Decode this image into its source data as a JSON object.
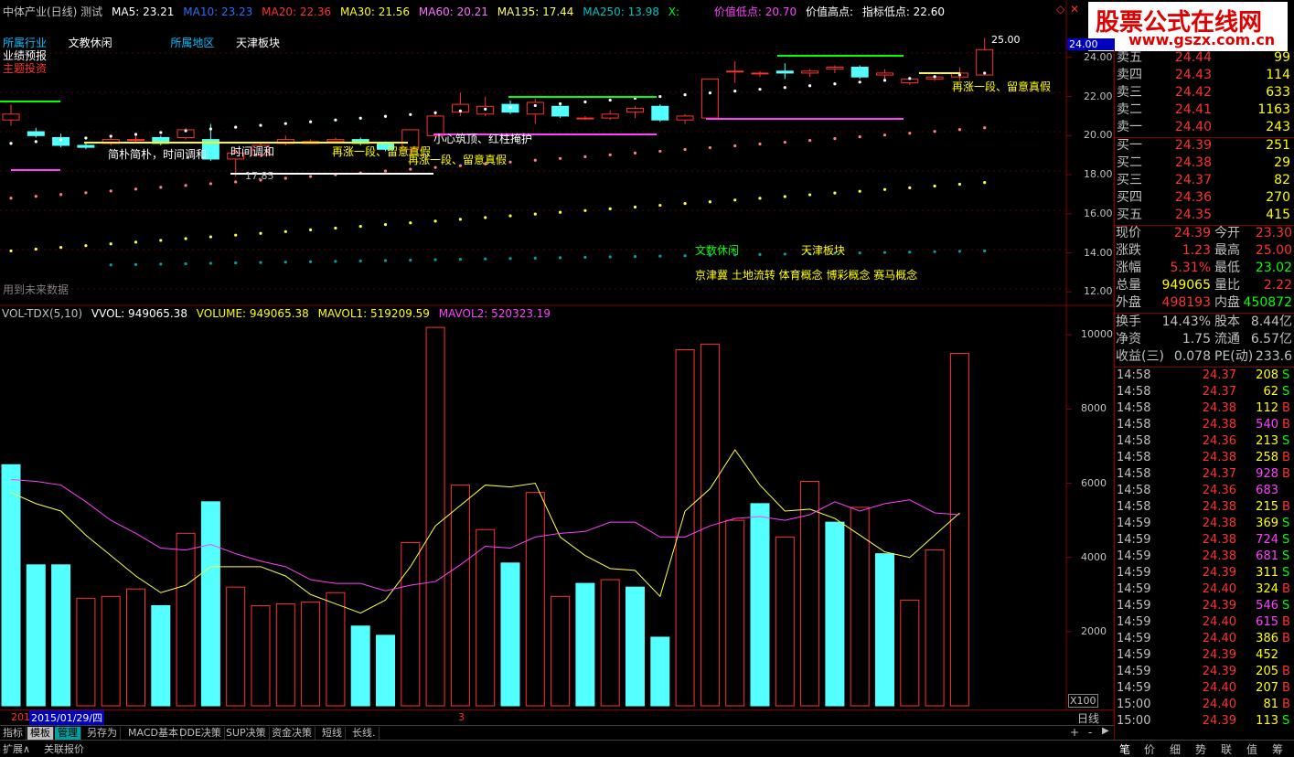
{
  "header": {
    "title": "中体产业(日线) 测试",
    "ma": [
      {
        "label": "MA5: 23.21",
        "color": "#ffffff"
      },
      {
        "label": "MA10: 23.23",
        "color": "#2a6cff"
      },
      {
        "label": "MA20: 22.36",
        "color": "#ff3030"
      },
      {
        "label": "MA30: 21.56",
        "color": "#ffff00"
      },
      {
        "label": "MA60: 20.21",
        "color": "#ff70ff"
      },
      {
        "label": "MA135: 17.44",
        "color": "#ffff60"
      },
      {
        "label": "MA250: 13.98",
        "color": "#00c0c0"
      },
      {
        "label": "X:",
        "color": "#00ff00"
      }
    ],
    "extra": [
      {
        "label": "价值低点: 20.70",
        "color": "#ff40ff"
      },
      {
        "label": "价值高点:",
        "color": "#ffffff"
      },
      {
        "label": "指标低点: 22.60",
        "color": "#ffffff"
      }
    ]
  },
  "logo": {
    "text": "股票公式在线网",
    "url": "www.gszx.com.cn"
  },
  "info": {
    "industry_label": "所属行业",
    "industry_value": "文教休闲",
    "region_label": "所属地区",
    "region_value": "天津板块",
    "forecast_label": "业绩预报",
    "theme_label": "主题投资",
    "future_label": "用到未来数据"
  },
  "annotations": {
    "a1": "简朴简朴，时间调和",
    "a2": "时间调和",
    "a3": "再涨一段、留意真假",
    "a4": "再涨一段、留意真假",
    "a5": "小心筑顶、红柱掩护",
    "a6": "再涨一段、留意真假",
    "low_value": "17.85",
    "high_value": "25.00",
    "sector1": "文数休闲",
    "sector2": "天津板块",
    "concepts": "京津冀 土地流转 体育概念 博彩概念 赛马概念"
  },
  "price_axis": {
    "labels": [
      "24.00",
      "22.00",
      "20.00",
      "18.00",
      "16.00",
      "14.00",
      "12.00"
    ],
    "current": "24.00"
  },
  "volume_header": {
    "name": "VOL-TDX(5,10)",
    "items": [
      {
        "label": "VVOL: 949065.38",
        "color": "#ffffff"
      },
      {
        "label": "VOLUME: 949065.38",
        "color": "#ffff00"
      },
      {
        "label": "MAVOL1: 519209.59",
        "color": "#ffff00"
      },
      {
        "label": "MAVOL2: 520323.19",
        "color": "#ff40ff"
      }
    ]
  },
  "volume_axis": {
    "labels": [
      "10000",
      "8000",
      "6000",
      "4000",
      "2000"
    ],
    "unit": "X100"
  },
  "chart_data": {
    "type": "bar",
    "title": "VOL-TDX(5,10)",
    "unit": "X100",
    "ylim": [
      0,
      10400
    ],
    "values": [
      6500,
      3800,
      3800,
      2900,
      2950,
      3150,
      2700,
      4650,
      5500,
      3200,
      2700,
      2750,
      2800,
      3050,
      2150,
      1900,
      4400,
      10200,
      5950,
      4750,
      3850,
      5750,
      2950,
      3300,
      3400,
      3200,
      1850,
      9600,
      9750,
      5000,
      5450,
      4550,
      6050,
      4950,
      5350,
      4100,
      2850,
      4200,
      9500
    ],
    "up": [
      false,
      false,
      false,
      true,
      true,
      true,
      false,
      true,
      false,
      true,
      true,
      true,
      true,
      true,
      false,
      false,
      true,
      true,
      true,
      true,
      false,
      true,
      true,
      false,
      true,
      false,
      false,
      true,
      true,
      true,
      false,
      true,
      true,
      false,
      true,
      false,
      true,
      true,
      true
    ],
    "mavol1": [
      5750,
      5450,
      5250,
      4600,
      4050,
      3500,
      3050,
      3250,
      3750,
      3750,
      3750,
      3500,
      3000,
      2750,
      2500,
      2850,
      3750,
      4850,
      5400,
      5950,
      5900,
      6000,
      4550,
      4050,
      3700,
      3650,
      2950,
      5250,
      5850,
      6900,
      5950,
      5250,
      5300,
      5050,
      4600,
      4150,
      4000,
      4600,
      5200
    ],
    "mavol2": [
      6100,
      6050,
      5950,
      5500,
      5000,
      4650,
      4250,
      4200,
      4350,
      4100,
      3900,
      3750,
      3400,
      3300,
      3300,
      3100,
      3250,
      3350,
      3800,
      4300,
      4250,
      4550,
      4650,
      4700,
      4950,
      4950,
      4550,
      4550,
      4850,
      5050,
      5100,
      5000,
      5150,
      5500,
      5250,
      5450,
      5550,
      5200,
      5150
    ]
  },
  "price_chart": {
    "candles": [
      {
        "o": 20.8,
        "c": 21.1,
        "h": 21.6,
        "l": 20.5
      },
      {
        "o": 20.2,
        "c": 20.0,
        "h": 20.4,
        "l": 19.9
      },
      {
        "o": 19.9,
        "c": 19.5,
        "h": 20.1,
        "l": 19.4
      },
      {
        "o": 19.5,
        "c": 19.4,
        "h": 19.6,
        "l": 19.3
      },
      {
        "o": 19.6,
        "c": 19.8,
        "h": 19.9,
        "l": 19.5
      },
      {
        "o": 19.8,
        "c": 19.8,
        "h": 20.0,
        "l": 19.6
      },
      {
        "o": 19.9,
        "c": 19.6,
        "h": 20.0,
        "l": 19.5
      },
      {
        "o": 19.9,
        "c": 20.3,
        "h": 20.4,
        "l": 19.8
      },
      {
        "o": 19.8,
        "c": 18.8,
        "h": 20.6,
        "l": 18.7
      },
      {
        "o": 18.8,
        "c": 19.1,
        "h": 19.3,
        "l": 17.9
      },
      {
        "o": 19.0,
        "c": 19.5,
        "h": 19.6,
        "l": 18.9
      },
      {
        "o": 19.6,
        "c": 19.8,
        "h": 20.0,
        "l": 19.5
      },
      {
        "o": 19.6,
        "c": 19.7,
        "h": 19.8,
        "l": 19.6
      },
      {
        "o": 19.7,
        "c": 19.8,
        "h": 19.9,
        "l": 19.6
      },
      {
        "o": 19.8,
        "c": 19.6,
        "h": 19.9,
        "l": 19.5
      },
      {
        "o": 19.6,
        "c": 19.3,
        "h": 19.7,
        "l": 19.2
      },
      {
        "o": 19.3,
        "c": 20.3,
        "h": 20.3,
        "l": 19.1
      },
      {
        "o": 20.0,
        "c": 21.0,
        "h": 21.2,
        "l": 19.9
      },
      {
        "o": 21.2,
        "c": 21.6,
        "h": 22.2,
        "l": 21.0
      },
      {
        "o": 21.1,
        "c": 21.5,
        "h": 22.0,
        "l": 21.0
      },
      {
        "o": 21.6,
        "c": 21.2,
        "h": 21.8,
        "l": 21.1
      },
      {
        "o": 21.1,
        "c": 21.7,
        "h": 21.9,
        "l": 20.6
      },
      {
        "o": 21.5,
        "c": 21.0,
        "h": 21.7,
        "l": 20.9
      },
      {
        "o": 20.9,
        "c": 20.9,
        "h": 21.0,
        "l": 20.8
      },
      {
        "o": 20.9,
        "c": 21.1,
        "h": 21.3,
        "l": 20.8
      },
      {
        "o": 21.2,
        "c": 21.4,
        "h": 21.5,
        "l": 20.9
      },
      {
        "o": 21.5,
        "c": 20.8,
        "h": 21.6,
        "l": 20.7
      },
      {
        "o": 20.8,
        "c": 21.0,
        "h": 21.1,
        "l": 20.6
      },
      {
        "o": 20.9,
        "c": 22.9,
        "h": 22.9,
        "l": 20.9
      },
      {
        "o": 23.3,
        "c": 23.3,
        "h": 23.8,
        "l": 22.7
      },
      {
        "o": 23.2,
        "c": 23.2,
        "h": 23.3,
        "l": 23.0
      },
      {
        "o": 23.3,
        "c": 23.2,
        "h": 23.7,
        "l": 22.9
      },
      {
        "o": 23.2,
        "c": 23.3,
        "h": 23.4,
        "l": 23.0
      },
      {
        "o": 23.4,
        "c": 23.5,
        "h": 23.6,
        "l": 23.2
      },
      {
        "o": 23.5,
        "c": 23.0,
        "h": 23.6,
        "l": 22.9
      },
      {
        "o": 23.1,
        "c": 23.2,
        "h": 23.4,
        "l": 22.8
      },
      {
        "o": 22.7,
        "c": 22.9,
        "h": 23.0,
        "l": 22.6
      },
      {
        "o": 22.9,
        "c": 23.0,
        "h": 23.1,
        "l": 22.8
      },
      {
        "o": 23.0,
        "c": 23.2,
        "h": 23.5,
        "l": 22.8
      },
      {
        "o": 23.1,
        "c": 24.4,
        "h": 25.0,
        "l": 23.1
      }
    ]
  },
  "quote": {
    "asks": [
      {
        "label": "卖五",
        "price": "24.44",
        "vol": "99"
      },
      {
        "label": "卖四",
        "price": "24.43",
        "vol": "114"
      },
      {
        "label": "卖三",
        "price": "24.42",
        "vol": "633"
      },
      {
        "label": "卖二",
        "price": "24.41",
        "vol": "1163"
      },
      {
        "label": "卖一",
        "price": "24.40",
        "vol": "243"
      }
    ],
    "bids": [
      {
        "label": "买一",
        "price": "24.39",
        "vol": "251"
      },
      {
        "label": "买二",
        "price": "24.38",
        "vol": "29"
      },
      {
        "label": "买三",
        "price": "24.37",
        "vol": "82"
      },
      {
        "label": "买四",
        "price": "24.36",
        "vol": "270"
      },
      {
        "label": "买五",
        "price": "24.35",
        "vol": "415"
      }
    ],
    "stats": [
      {
        "k1": "现价",
        "v1": "24.39",
        "c1": "#ff3030",
        "k2": "今开",
        "v2": "23.30",
        "c2": "#ff3030"
      },
      {
        "k1": "涨跌",
        "v1": "1.23",
        "c1": "#ff3030",
        "k2": "最高",
        "v2": "25.00",
        "c2": "#ff3030"
      },
      {
        "k1": "涨幅",
        "v1": "5.31%",
        "c1": "#ff3030",
        "k2": "最低",
        "v2": "23.02",
        "c2": "#00ff00"
      },
      {
        "k1": "总量",
        "v1": "949065",
        "c1": "#ffff00",
        "k2": "量比",
        "v2": "2.22",
        "c2": "#ff3030"
      },
      {
        "k1": "外盘",
        "v1": "498193",
        "c1": "#ff3030",
        "k2": "内盘",
        "v2": "450872",
        "c2": "#00ff00"
      }
    ],
    "stats2": [
      {
        "k1": "换手",
        "v1": "14.43%",
        "c1": "#c0c0c0",
        "k2": "股本",
        "v2": "8.44亿",
        "c2": "#c0c0c0"
      },
      {
        "k1": "净资",
        "v1": "1.75",
        "c1": "#c0c0c0",
        "k2": "流通",
        "v2": "6.57亿",
        "c2": "#c0c0c0"
      },
      {
        "k1": "收益(三)",
        "v1": "0.078",
        "c1": "#c0c0c0",
        "k2": "PE(动)",
        "v2": "233.6",
        "c2": "#c0c0c0"
      }
    ],
    "ticks": [
      {
        "t": "14:58",
        "p": "24.37",
        "v": "208",
        "f": "S"
      },
      {
        "t": "14:58",
        "p": "24.37",
        "v": "62",
        "f": "S"
      },
      {
        "t": "14:58",
        "p": "24.38",
        "v": "112",
        "f": "B"
      },
      {
        "t": "14:58",
        "p": "24.38",
        "v": "540",
        "f": "B"
      },
      {
        "t": "14:58",
        "p": "24.36",
        "v": "213",
        "f": "S"
      },
      {
        "t": "14:58",
        "p": "24.38",
        "v": "258",
        "f": "B"
      },
      {
        "t": "14:58",
        "p": "24.37",
        "v": "928",
        "f": "B"
      },
      {
        "t": "14:58",
        "p": "24.36",
        "v": "683",
        "f": ""
      },
      {
        "t": "14:58",
        "p": "24.38",
        "v": "215",
        "f": "B"
      },
      {
        "t": "14:59",
        "p": "24.38",
        "v": "369",
        "f": "S"
      },
      {
        "t": "14:59",
        "p": "24.38",
        "v": "724",
        "f": "S"
      },
      {
        "t": "14:59",
        "p": "24.38",
        "v": "681",
        "f": "S"
      },
      {
        "t": "14:59",
        "p": "24.39",
        "v": "311",
        "f": "S"
      },
      {
        "t": "14:59",
        "p": "24.40",
        "v": "324",
        "f": "B"
      },
      {
        "t": "14:59",
        "p": "24.39",
        "v": "546",
        "f": "S"
      },
      {
        "t": "14:59",
        "p": "24.40",
        "v": "615",
        "f": "B"
      },
      {
        "t": "14:59",
        "p": "24.40",
        "v": "386",
        "f": "B"
      },
      {
        "t": "14:59",
        "p": "24.39",
        "v": "452",
        "f": ""
      },
      {
        "t": "14:59",
        "p": "24.39",
        "v": "205",
        "f": "B"
      },
      {
        "t": "14:59",
        "p": "24.40",
        "v": "207",
        "f": "B"
      },
      {
        "t": "15:00",
        "p": "24.40",
        "v": "81",
        "f": "B"
      },
      {
        "t": "15:00",
        "p": "24.39",
        "v": "113",
        "f": "S"
      }
    ]
  },
  "timebar": {
    "year": "201",
    "date": "2015/01/29/四",
    "mark": "3",
    "period": "日线"
  },
  "tabs": [
    "指标",
    "模板",
    "管理",
    "另存为",
    "MACD基本",
    "DDE决策",
    "SUP决策",
    "资金决策",
    "短线",
    "长线."
  ],
  "bottom": {
    "expand": "扩展∧",
    "related": "关联报价"
  },
  "right_tabs": [
    "笔",
    "价",
    "细",
    "势",
    "联",
    "值",
    "筹"
  ]
}
